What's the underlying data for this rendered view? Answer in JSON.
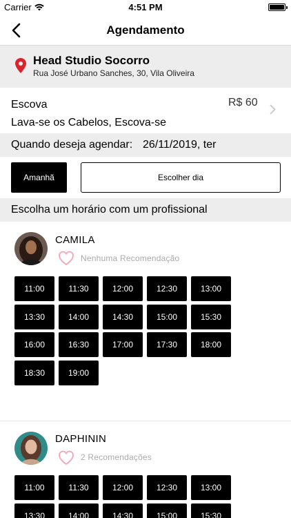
{
  "status_bar": {
    "carrier": "Carrier",
    "time": "4:51 PM"
  },
  "nav": {
    "title": "Agendamento"
  },
  "salon": {
    "name": "Head Studio Socorro",
    "address": "Rua José Urbano Sanches, 30, Vila Oliveira"
  },
  "service": {
    "name": "Escova",
    "description": "Lava-se os Cabelos, Escova-se",
    "price": "R$ 60"
  },
  "when": {
    "label": "Quando deseja agendar:",
    "value": "26/11/2019, ter"
  },
  "date_buttons": {
    "tomorrow": "Amanhã",
    "choose_day": "Escolher dia"
  },
  "section_title": "Escolha um horário com um profissional",
  "professionals": [
    {
      "name": "CAMILA",
      "recommendations": "Nenhuma Recomendação",
      "slots": [
        "11:00",
        "11:30",
        "12:00",
        "12:30",
        "13:00",
        "13:30",
        "14:00",
        "14:30",
        "15:00",
        "15:30",
        "16:00",
        "16:30",
        "17:00",
        "17:30",
        "18:00",
        "18:30",
        "19:00"
      ]
    },
    {
      "name": "DAPHININ",
      "recommendations": "2 Recomendações",
      "slots": [
        "11:00",
        "11:30",
        "12:00",
        "12:30",
        "13:00",
        "13:30",
        "14:00",
        "14:30",
        "15:00",
        "15:30"
      ]
    }
  ],
  "colors": {
    "accent": "#000000",
    "pin": "#d9232d",
    "heart": "#f0a5b5",
    "section_bg": "#ededed"
  }
}
